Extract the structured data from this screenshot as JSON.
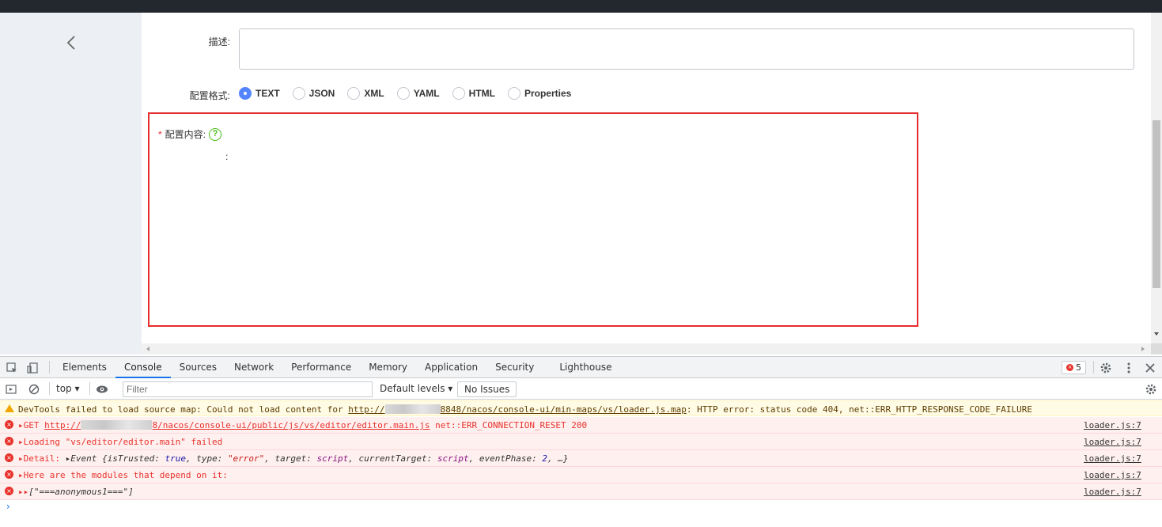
{
  "form": {
    "desc_label": "描述:",
    "format_label": "配置格式:",
    "formats": [
      {
        "label": "TEXT",
        "checked": true
      },
      {
        "label": "JSON",
        "checked": false
      },
      {
        "label": "XML",
        "checked": false
      },
      {
        "label": "YAML",
        "checked": false
      },
      {
        "label": "HTML",
        "checked": false
      },
      {
        "label": "Properties",
        "checked": false
      }
    ],
    "required_mark": "*",
    "content_label": "配置内容:",
    "help_glyph": "?",
    "colon": ":"
  },
  "devtools": {
    "tabs": [
      "Elements",
      "Console",
      "Sources",
      "Network",
      "Performance",
      "Memory",
      "Application",
      "Security",
      "Lighthouse"
    ],
    "active_tab": "Console",
    "error_count": "5",
    "context": "top",
    "filter_placeholder": "Filter",
    "levels": "Default levels",
    "no_issues": "No Issues",
    "warning": {
      "prefix": "DevTools failed to load source map: Could not load content for ",
      "url_start": "http://",
      "url_end": "8848/nacos/console-ui/min-maps/vs/loader.js.map",
      "suffix": ": HTTP error: status code 404, net::ERR_HTTP_RESPONSE_CODE_FAILURE"
    },
    "errors": [
      {
        "pre": "GET ",
        "url_start": "http://",
        "url_end": "8/nacos/console-ui/public/js/vs/editor/editor.main.js",
        "post": " net::ERR_CONNECTION_RESET 200",
        "source": "loader.js:7"
      },
      {
        "text": "Loading \"vs/editor/editor.main\" failed",
        "source": "loader.js:7"
      },
      {
        "text": "Detail:",
        "source": "loader.js:7"
      },
      {
        "text": "Here are the modules that depend on it:",
        "source": "loader.js:7"
      },
      {
        "text": "[\"===anonymous1===\"]",
        "source": "loader.js:7"
      }
    ],
    "detail_event": {
      "name": "Event",
      "isTrusted": "true",
      "type": "\"error\"",
      "target": "script",
      "currentTarget": "script",
      "eventPhase": "2"
    },
    "prompt": "›"
  }
}
